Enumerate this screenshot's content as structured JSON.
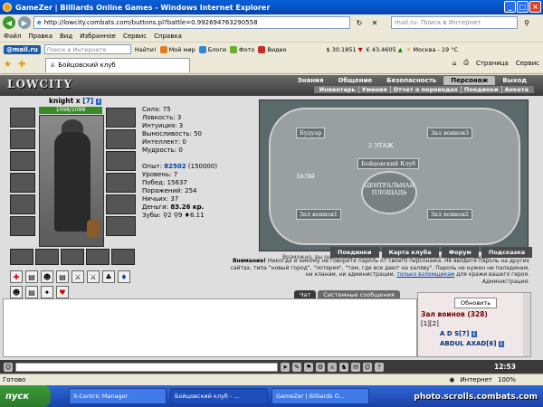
{
  "window": {
    "title": "GameZer | Billiards Online Games - Windows Internet Explorer"
  },
  "address": {
    "url": "http://lowcity.combats.com/buttons.pl?battle=0.992694763290558",
    "search_placeholder": "mail.ru: Поиск в Интернет"
  },
  "menu": [
    "Файл",
    "Правка",
    "Вид",
    "Избранное",
    "Сервис",
    "Справка"
  ],
  "mailbar": {
    "logo": "@mail.ru",
    "search_placeholder": "Поиск в Интернете",
    "find": "Найти!",
    "items": [
      "Мой мир",
      "Блоги",
      "Фото",
      "Видео"
    ],
    "rate_usd": "$ 30.1851",
    "rate_eur": "€ 43.4605",
    "weather": "Москва - 19 °C"
  },
  "tabs": {
    "current": "Бойцовский клуб",
    "page": "Страница",
    "tools": "Сервис"
  },
  "game": {
    "logo": "LOWCITY",
    "nav": [
      "Знания",
      "Общение",
      "Безопасность",
      "Персонаж",
      "Выход"
    ],
    "subnav": [
      "Инвентарь",
      "Умения",
      "Отчет о переводах",
      "Поединки",
      "Анкета"
    ],
    "hero": {
      "name": "knight x",
      "level": "[7]",
      "hp": "1098/1098"
    },
    "stats": {
      "strength": "Сила: 75",
      "agility": "Ловкость: 3",
      "intuition": "Интуиция: 3",
      "endurance": "Выносливость: 50",
      "intellect": "Интеллект: 0",
      "wisdom": "Мудрость: 0",
      "exp_label": "Опыт:",
      "exp": "82502",
      "exp_next": "(150000)",
      "level": "Уровень: 7",
      "wins": "Побед: 15637",
      "losses": "Поражений: 254",
      "draws": "Ничьих: 37",
      "money_label": "Деньги:",
      "money": "83.26 кр.",
      "teeth": "Зубы: ⚲2 ⚲9 ♦6.11"
    },
    "map": {
      "room_tl": "Будуар",
      "room_tr": "Зал воинов3",
      "room_bl": "Зал воинов1",
      "room_br": "Зал воинов2",
      "center": "ЦЕНТРАЛЬНАЯ ПЛОЩАДЬ",
      "floor": "2 ЭТАЖ",
      "club": "Бойцовский Клуб",
      "halls": "ЗАЛЫ",
      "note": "Возможно, вы ошиблись этажом - настоящие сражения проходят выше."
    },
    "buttons": [
      "Поединки",
      "Карта клуба",
      "Форум",
      "Подсказка"
    ],
    "warning_bold": "Внимание!",
    "warning": "Никогда и никому не говорите пароль от своего персонажа. Не вводите пароль на других сайтах, типа \"новый город\", \"лотерея\", \"там, где все дают на халяву\". Пароль не нужен ни паладинам, ни кланам, ни администрации,",
    "warning_link": "только взломщикам",
    "warning_end": "для кражи вашего героя.",
    "warning_sign": "Администрация."
  },
  "chat": {
    "tab_chat": "Чат",
    "tab_system": "Системные сообщения",
    "refresh": "Обновить",
    "hall": "Зал воинов (328)",
    "pages": "[1][2]",
    "players": [
      "A D S[7]",
      "ABDUL AXAD[6]"
    ],
    "time": "12:53"
  },
  "status": {
    "left": "Готово",
    "zone": "Интернет",
    "zoom": "100%"
  },
  "taskbar": {
    "start": "пуск",
    "tasks": [
      "X-Centric Manager",
      "Бойцовский клуб - ...",
      "GameZer | Billiards O..."
    ]
  },
  "watermark": "photo.scrolls.combats.com"
}
